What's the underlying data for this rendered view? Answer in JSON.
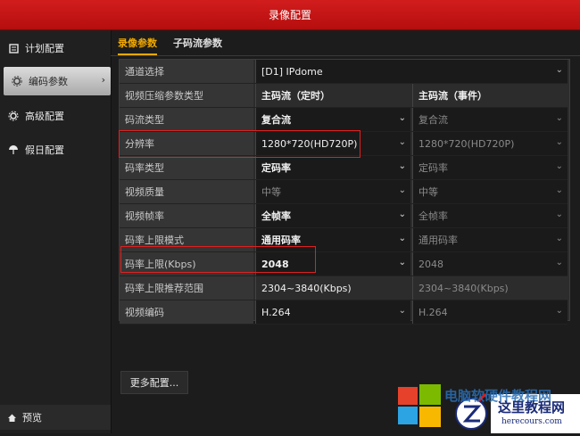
{
  "window": {
    "title": "录像配置"
  },
  "sidebar": {
    "items": [
      {
        "label": "计划配置",
        "icon": "schedule-icon"
      },
      {
        "label": "编码参数",
        "icon": "gear-icon",
        "active": true
      },
      {
        "label": "高级配置",
        "icon": "advanced-icon"
      },
      {
        "label": "假日配置",
        "icon": "umbrella-icon"
      }
    ],
    "preview_label": "预览"
  },
  "tabs": [
    {
      "label": "录像参数",
      "active": true
    },
    {
      "label": "子码流参数",
      "active": false
    }
  ],
  "form": {
    "channel": {
      "label": "通道选择",
      "value": "[D1] IPdome"
    },
    "header": {
      "label": "视频压缩参数类型",
      "main": "主码流（定时）",
      "event": "主码流（事件）"
    },
    "rows": [
      {
        "label": "码流类型",
        "main": "复合流",
        "event": "复合流"
      },
      {
        "label": "分辨率",
        "main": "1280*720(HD720P)",
        "event": "1280*720(HD720P)"
      },
      {
        "label": "码率类型",
        "main": "定码率",
        "event": "定码率"
      },
      {
        "label": "视频质量",
        "main": "中等",
        "event": "中等"
      },
      {
        "label": "视频帧率",
        "main": "全帧率",
        "event": "全帧率"
      },
      {
        "label": "码率上限模式",
        "main": "通用码率",
        "event": "通用码率"
      },
      {
        "label": "码率上限(Kbps)",
        "main": "2048",
        "event": "2048"
      },
      {
        "label": "码率上限推荐范围",
        "main": "2304~3840(Kbps)",
        "event": "2304~3840(Kbps)"
      },
      {
        "label": "视频编码",
        "main": "H.264",
        "event": "H.264"
      }
    ]
  },
  "more_button": "更多配置...",
  "watermark": {
    "text": "这里教程网",
    "url": "herecours.com",
    "faded_text": "电脑软硬件教程网"
  },
  "colors": {
    "accent": "#f2a900",
    "title_bar": "#c51515",
    "highlight_box": "#e02020"
  }
}
